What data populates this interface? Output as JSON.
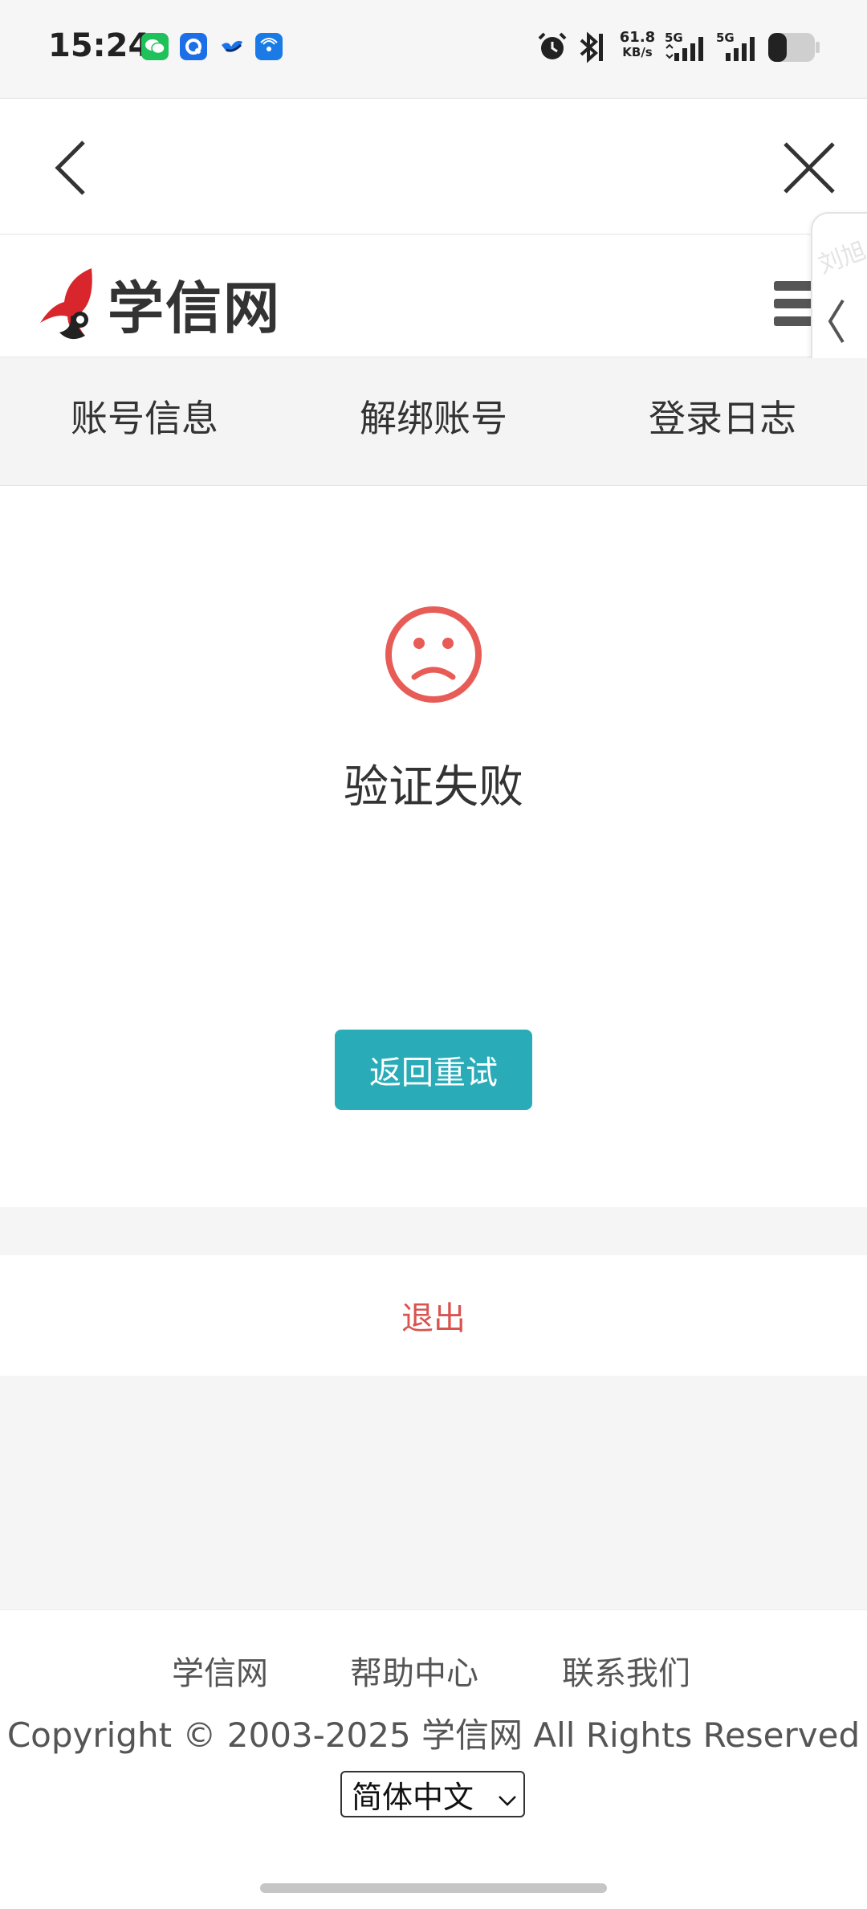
{
  "status_bar": {
    "time": "15:24",
    "network_speed_value": "61.8",
    "network_speed_unit": "KB/s",
    "sim1_label": "5G",
    "sim2_label": "5G",
    "app_icons": [
      "wechat-icon",
      "qq-browser-icon",
      "bird-app-icon",
      "radio-app-icon"
    ],
    "system_icons": [
      "alarm-icon",
      "bluetooth-icon",
      "signal-icon",
      "signal-icon",
      "battery-icon"
    ],
    "battery_level": 0.4
  },
  "browser_nav": {
    "back_icon": "chevron-left-icon",
    "close_icon": "close-icon"
  },
  "site_header": {
    "logo_text": "学信网",
    "menu_icon": "hamburger-menu-icon"
  },
  "side_tab": {
    "watermark": "刘旭",
    "icon": "chevron-left-icon"
  },
  "tabs": [
    {
      "label": "账号信息"
    },
    {
      "label": "解绑账号"
    },
    {
      "label": "登录日志"
    }
  ],
  "main": {
    "status_icon": "sad-face-icon",
    "status_title": "验证失败",
    "retry_label": "返回重试",
    "accent_color": "#2aacb8",
    "error_color": "#e85c57"
  },
  "logout": {
    "label": "退出"
  },
  "footer": {
    "links": [
      "学信网",
      "帮助中心",
      "联系我们"
    ],
    "copyright": "Copyright © 2003-2025 学信网 All Rights Reserved",
    "language_selected": "简体中文"
  }
}
